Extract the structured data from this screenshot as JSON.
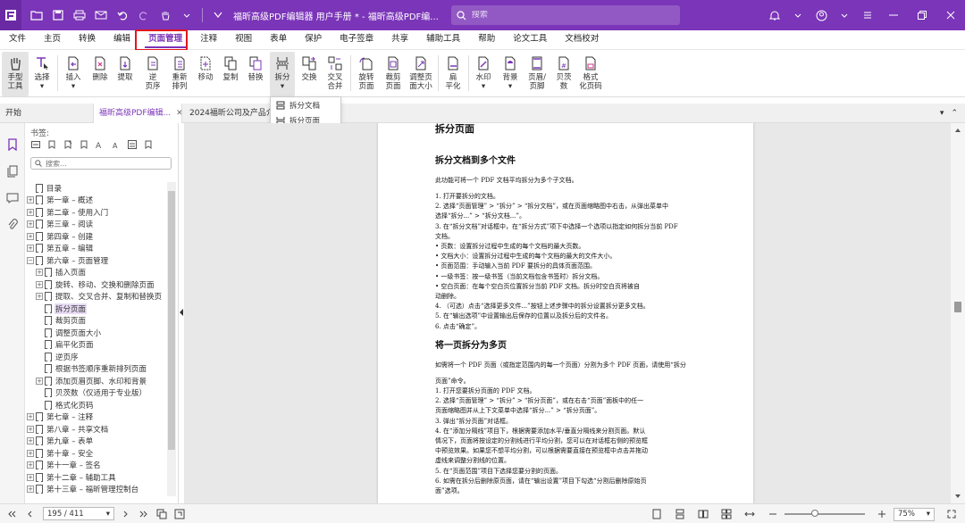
{
  "titlebar": {
    "title": "福昕高级PDF编辑器 用户手册 * - 福昕高级PDF编...",
    "search_placeholder": "搜索",
    "accent": "#7b35b8"
  },
  "menu": {
    "items": [
      "文件",
      "主页",
      "转换",
      "编辑",
      "页面管理",
      "注释",
      "视图",
      "表单",
      "保护",
      "电子签章",
      "共享",
      "辅助工具",
      "帮助",
      "论文工具",
      "文档校对"
    ],
    "active_index": 4
  },
  "ribbon": {
    "hand": "手型\n工具",
    "select": "选择",
    "insert": "插入",
    "delete": "删除",
    "extract": "提取",
    "reverse": "逆\n页序",
    "reorder": "重新\n排列",
    "move": "移动",
    "copy": "复制",
    "replace": "替换",
    "split": "拆分",
    "swap": "交换",
    "interleave": "交叉\n合并",
    "rotate": "旋转\n页面",
    "crop": "裁剪\n页面",
    "resize": "调整页\n面大小",
    "flatten": "扁\n平化",
    "watermark": "水印",
    "background": "背景",
    "header_footer": "页眉/\n页脚",
    "bates": "贝茨\n数",
    "format_page_num": "格式\n化页码"
  },
  "split_menu": {
    "items": [
      "拆分文档",
      "拆分页面"
    ]
  },
  "tabs": {
    "start": "开始",
    "doc1": "福昕高级PDF编辑...",
    "doc2": "2024福昕公司及产品介..."
  },
  "bookmarks": {
    "title": "书签:",
    "search_placeholder": "搜索...",
    "items": [
      {
        "label": "目录",
        "exp": false,
        "indent": 0
      },
      {
        "label": "第一章 – 概述",
        "exp": true,
        "indent": 0
      },
      {
        "label": "第二章 – 使用入门",
        "exp": true,
        "indent": 0
      },
      {
        "label": "第三章 – 阅读",
        "exp": true,
        "indent": 0
      },
      {
        "label": "第四章 – 创建",
        "exp": true,
        "indent": 0
      },
      {
        "label": "第五章 – 编辑",
        "exp": true,
        "indent": 0
      },
      {
        "label": "第六章 – 页面管理",
        "exp": true,
        "expanded": true,
        "indent": 0
      },
      {
        "label": "插入页面",
        "exp": true,
        "indent": 1
      },
      {
        "label": "旋转、移动、交换和删除页面",
        "exp": true,
        "indent": 1
      },
      {
        "label": "提取、交叉合并、复制和替换页",
        "exp": true,
        "indent": 1
      },
      {
        "label": "拆分页面",
        "exp": false,
        "indent": 1,
        "selected": true
      },
      {
        "label": "裁剪页面",
        "exp": false,
        "indent": 1
      },
      {
        "label": "调整页面大小",
        "exp": false,
        "indent": 1
      },
      {
        "label": "扁平化页面",
        "exp": false,
        "indent": 1
      },
      {
        "label": "逆页序",
        "exp": false,
        "indent": 1
      },
      {
        "label": "根据书签顺序重新排列页面",
        "exp": false,
        "indent": 1
      },
      {
        "label": "添加页眉页脚、水印和背景",
        "exp": true,
        "indent": 1
      },
      {
        "label": "贝茨数（仅适用于专业版）",
        "exp": false,
        "indent": 1
      },
      {
        "label": "格式化页码",
        "exp": false,
        "indent": 1
      },
      {
        "label": "第七章 – 注释",
        "exp": true,
        "indent": 0
      },
      {
        "label": "第八章 – 共享文档",
        "exp": true,
        "indent": 0
      },
      {
        "label": "第九章 – 表单",
        "exp": true,
        "indent": 0
      },
      {
        "label": "第十章 – 安全",
        "exp": true,
        "indent": 0
      },
      {
        "label": "第十一章 – 签名",
        "exp": true,
        "indent": 0
      },
      {
        "label": "第十二章 – 辅助工具",
        "exp": true,
        "indent": 0
      },
      {
        "label": "第十三章 – 福昕管理控制台",
        "exp": true,
        "indent": 0
      }
    ]
  },
  "document": {
    "lines": [
      {
        "t": "拆分页面",
        "c": "h1"
      },
      {
        "t": "拆分文档到多个文件",
        "c": "h2"
      },
      {
        "t": "此功能可将一个 PDF 文档平均拆分为多个子文档。",
        "c": ""
      },
      {
        "t": "1.   打开要拆分的文档。",
        "c": ""
      },
      {
        "t": "2.   选择“页面管理” > “拆分” > “拆分文档”，或在页面缩略图中右击，从弹出菜单中",
        "c": ""
      },
      {
        "t": "       选择“拆分...” > “拆分文档...”。",
        "c": ""
      },
      {
        "t": "3.   在“拆分文档”对话框中，在“拆分方式”项下中选择一个选项以指定如何拆分当前 PDF",
        "c": ""
      },
      {
        "t": "       文档。",
        "c": ""
      },
      {
        "t": "         •    页数：设置拆分过程中生成的每个文档的最大页数。",
        "c": ""
      },
      {
        "t": "         •    文档大小：设置拆分过程中生成的每个文档的最大的文件大小。",
        "c": ""
      },
      {
        "t": "         •    页面范围：手动输入当前 PDF 要拆分的具体页面范围。",
        "c": ""
      },
      {
        "t": "         •    一级书签：按一级书签（当前文档包含书签时）拆分文档。",
        "c": ""
      },
      {
        "t": "         •    空白页面：在每个空白页位置拆分当前 PDF 文档。拆分时空白页将被自",
        "c": ""
      },
      {
        "t": "               动删除。",
        "c": ""
      },
      {
        "t": "4.   （可选）点击“选择更多文件...”按钮上述步骤中的拆分设置拆分更多文档。",
        "c": ""
      },
      {
        "t": "5.   在“输出选项”中设置输出后保存的位置以及拆分后的文件名。",
        "c": ""
      },
      {
        "t": "6.   点击“确定”。",
        "c": ""
      },
      {
        "t": "将一页拆分为多页",
        "c": "h2"
      },
      {
        "t": "如需将一个 PDF 页面（或指定范围内的每一个页面）分割为多个 PDF 页面，请使用“拆分",
        "c": ""
      },
      {
        "t": "页面”命令。",
        "c": ""
      },
      {
        "t": "1.   打开您要拆分页面的 PDF 文档。",
        "c": ""
      },
      {
        "t": "2.   选择“页面管理” > “拆分” > “拆分页面”，或在右击“页面”面板中的任一",
        "c": ""
      },
      {
        "t": "       页面缩略图并从上下文菜单中选择“拆分...” > “拆分页面”。",
        "c": ""
      },
      {
        "t": "3.   弹出“拆分页面”对话框。",
        "c": ""
      },
      {
        "t": "4.   在“添加分隔线”项目下，根据需要添加水平/垂直分隔线来分割页面。默认",
        "c": ""
      },
      {
        "t": "       情况下，页面将按设定的分割线进行平均分割，您可以在对话框右侧的预览框",
        "c": ""
      },
      {
        "t": "       中预览效果。如果您不想平均分割，可以根据需要直接在预览框中点击并拖动",
        "c": ""
      },
      {
        "t": "       虚线来调整分割线的位置。",
        "c": ""
      },
      {
        "t": "5.   在“页面范围”项目下选择您要分割的页面。",
        "c": ""
      },
      {
        "t": "6.   如需在拆分后删除原页面，请在“输出设置”项目下勾选“分割后删除原始页",
        "c": ""
      },
      {
        "t": "       面”选项。",
        "c": ""
      }
    ]
  },
  "statusbar": {
    "page": "195 / 411",
    "zoom": "75%",
    "zoom_fraction": 0.36
  }
}
